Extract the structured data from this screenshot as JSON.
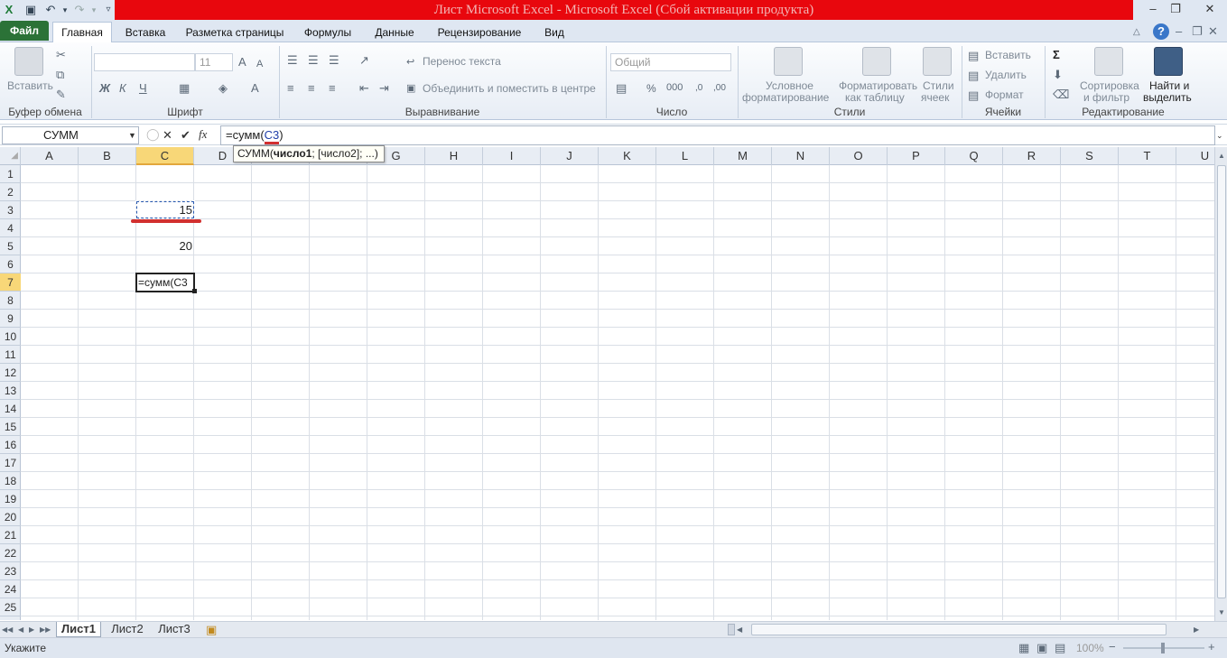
{
  "window": {
    "title": "Лист Microsoft Excel  -  Microsoft Excel (Сбой активации продукта)"
  },
  "tabs": [
    "Файл",
    "Главная",
    "Вставка",
    "Разметка страницы",
    "Формулы",
    "Данные",
    "Рецензирование",
    "Вид"
  ],
  "ribbon": {
    "clipboard": {
      "paste": "Вставить",
      "group": "Буфер обмена"
    },
    "font": {
      "font_name": "",
      "font_size": "11",
      "group": "Шрифт",
      "bold": "Ж",
      "italic": "К",
      "underline": "Ч"
    },
    "alignment": {
      "wrap": "Перенос текста",
      "merge": "Объединить и поместить в центре",
      "group": "Выравнивание"
    },
    "number": {
      "format": "Общий",
      "percent": "%",
      "thousands": "000",
      "group": "Число"
    },
    "styles": {
      "conditional_1": "Условное",
      "conditional_2": "форматирование",
      "as_table_1": "Форматировать",
      "as_table_2": "как таблицу",
      "cell_styles_1": "Стили",
      "cell_styles_2": "ячеек",
      "group": "Стили"
    },
    "cells": {
      "insert": "Вставить",
      "delete": "Удалить",
      "format": "Формат",
      "group": "Ячейки"
    },
    "editing": {
      "sort_1": "Сортировка",
      "sort_2": "и фильтр",
      "find_1": "Найти и",
      "find_2": "выделить",
      "group": "Редактирование"
    }
  },
  "formula_bar": {
    "name_box": "СУММ",
    "fx": "fx",
    "formula_prefix": "=сумм(",
    "formula_ref": "C3",
    "tooltip_fn": "СУММ(",
    "tooltip_arg1": "число1",
    "tooltip_rest": "; [число2]; ...)"
  },
  "columns": [
    "A",
    "B",
    "C",
    "D",
    "E",
    "F",
    "G",
    "H",
    "I",
    "J",
    "K",
    "L",
    "M",
    "N",
    "O",
    "P",
    "Q",
    "R",
    "S",
    "T",
    "U"
  ],
  "selected_column": "C",
  "rows": [
    "1",
    "2",
    "3",
    "4",
    "5",
    "6",
    "7",
    "8",
    "9",
    "10",
    "11",
    "12",
    "13",
    "14",
    "15",
    "16",
    "17",
    "18",
    "19",
    "20",
    "21",
    "22",
    "23",
    "24",
    "25"
  ],
  "selected_row": "7",
  "cells": {
    "c3": "15",
    "c5": "20",
    "c7": "=сумм(С3"
  },
  "sheets": [
    "Лист1",
    "Лист2",
    "Лист3"
  ],
  "active_sheet": "Лист1",
  "status": {
    "mode": "Укажите",
    "zoom": "100%"
  },
  "colors": {
    "accent_red": "#e8070d",
    "file_tab": "#2b7237",
    "selected_header": "#f8d778"
  }
}
